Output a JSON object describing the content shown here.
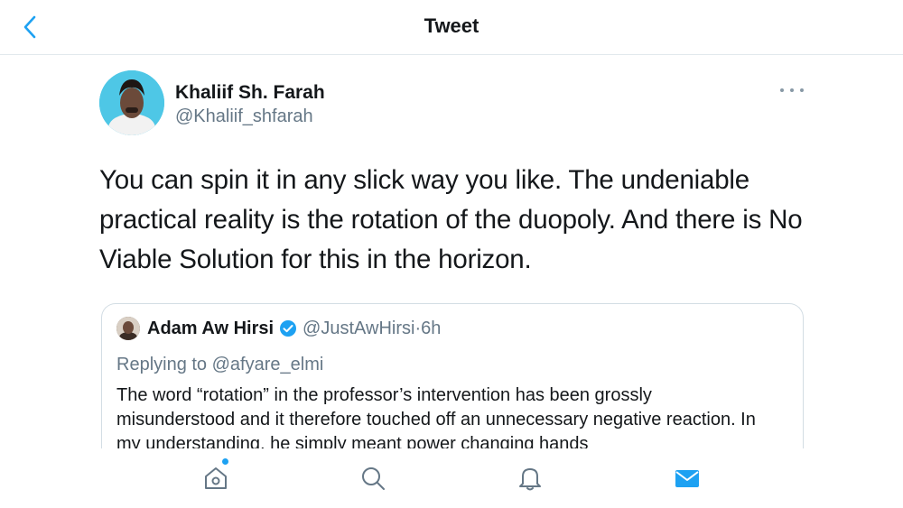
{
  "header": {
    "title": "Tweet"
  },
  "tweet": {
    "author_name": "Khaliif Sh. Farah",
    "author_handle": "@Khaliif_shfarah",
    "text": "You can spin it in any slick way you like. The undeniable practical reality is the rotation of the duopoly. And there is No Viable Solution for this in the horizon."
  },
  "quoted_tweet": {
    "author_name": "Adam Aw Hirsi",
    "author_handle": "@JustAwHirsi",
    "separator": "·",
    "time": "6h",
    "replying_to_label": "Replying to",
    "replying_to_user": "@afyare_elmi",
    "text": "The word “rotation” in the professor’s intervention has been grossly misunderstood and it therefore touched off an unnecessary negative reaction. In my understanding, he simply meant power changing hands"
  },
  "colors": {
    "accent": "#1da1f2",
    "secondary_text": "#657786",
    "border": "#e1e8ed"
  },
  "tabbar": {
    "items": [
      {
        "icon": "home-icon",
        "has_dot": true
      },
      {
        "icon": "search-icon"
      },
      {
        "icon": "notifications-icon"
      },
      {
        "icon": "mail-icon",
        "active": true
      }
    ]
  }
}
